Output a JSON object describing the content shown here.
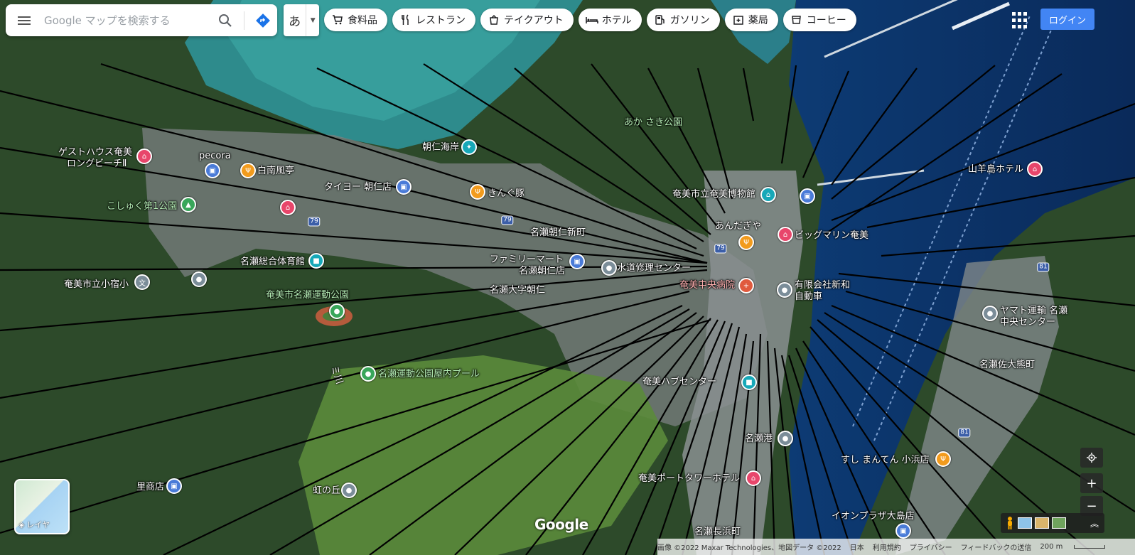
{
  "search": {
    "placeholder": "Google マップを検索する"
  },
  "ime": {
    "char": "あ"
  },
  "chips": [
    {
      "label": "食料品",
      "icon": "cart-icon"
    },
    {
      "label": "レストラン",
      "icon": "restaurant-icon"
    },
    {
      "label": "テイクアウト",
      "icon": "takeout-icon"
    },
    {
      "label": "ホテル",
      "icon": "hotel-icon"
    },
    {
      "label": "ガソリン",
      "icon": "gas-icon"
    },
    {
      "label": "薬局",
      "icon": "pharmacy-icon"
    },
    {
      "label": "コーヒー",
      "icon": "coffee-icon"
    }
  ],
  "login_label": "ログイン",
  "labels": {
    "guesthouse": "ゲストハウス奄美",
    "guesthouse2": "ロングビーチⅡ",
    "pecora": "pecora",
    "hakunan": "白南風亭",
    "koshiyuku": "こしゅく第1公園",
    "taiyo": "タイヨー 朝仁店",
    "asani_beach": "朝仁海岸",
    "akasaki": "あか さき公園",
    "kindai": "きんぐ豚",
    "museum": "奄美市立奄美博物館",
    "naze_gym": "名瀬総合体育館",
    "famima": "ファミリーマート",
    "naze_asani": "名瀬朝仁店",
    "suido": "水道修理センター",
    "school": "奄美市立小宿小",
    "naze_park": "奄美市名瀬運動公園",
    "naze_daigaku": "名瀬大字朝仁",
    "andagiya": "あんだぎや",
    "bigmarine": "ビッグマリン奄美",
    "hospital": "奄美中央病院",
    "shinwa": "有限会社新和",
    "shinwa2": "自動車",
    "yamabe_hotel": "山羊島ホテル",
    "yamato": "ヤマト運輸 名瀬",
    "yamato2": "中央センター",
    "sasaki": "名瀬佐大熊町",
    "pool": "名瀬運動公園屋内プール",
    "hub": "奄美ハブセンター",
    "naze_port": "名瀬港",
    "sushi": "すし まんてん 小浜店",
    "port_tower": "奄美ポートタワーホテル",
    "aeon": "イオンプラザ大島店",
    "naze_nagahama": "名瀬長浜町",
    "niji": "虹の丘",
    "sato": "里商店",
    "river": "ミ川",
    "naze_street": "名瀬朝仁新町"
  },
  "routes": [
    "79",
    "79",
    "79",
    "81",
    "81"
  ],
  "layer_label": "レイヤ",
  "google_logo": "Google",
  "footer": {
    "imagery": "画像 ©2022 Maxar Technologies、地図データ ©2022",
    "lang": "日本",
    "terms": "利用規約",
    "privacy": "プライバシー",
    "feedback": "フィードバックの送信",
    "scale": "200 m"
  }
}
